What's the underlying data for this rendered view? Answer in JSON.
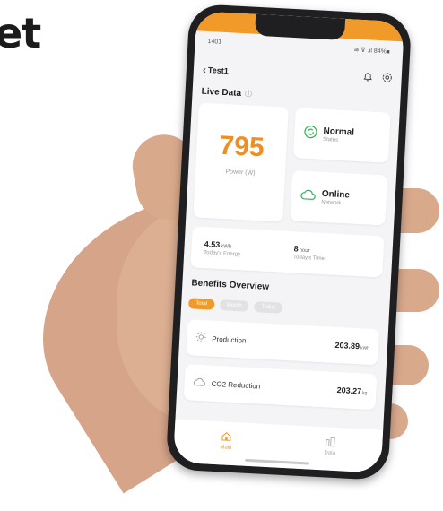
{
  "headline": "et",
  "phone": {
    "status_time": "1401",
    "status_right": "≋ ⊽ .ıl 84%∎",
    "nav": {
      "back_glyph": "‹",
      "device_name": "Test1"
    },
    "live_data": {
      "title": "Live Data",
      "info_glyph": "ⓘ"
    },
    "power": {
      "value": "795",
      "label": "Power (W)"
    },
    "status_card": {
      "title": "Normal",
      "sub": "Status"
    },
    "network_card": {
      "title": "Online",
      "sub": "Network"
    },
    "energy": {
      "value": "4.53",
      "unit": "kWh",
      "label": "Today's Energy"
    },
    "time": {
      "value": "8",
      "unit": "hour",
      "label": "Today's Time"
    },
    "benefits": {
      "title": "Benefits Overview",
      "tabs": [
        "Total",
        "Month",
        "Today"
      ],
      "active_tab": "Total",
      "production": {
        "label": "Production",
        "value": "203.89",
        "unit": "kWh"
      },
      "co2": {
        "label": "CO2 Reduction",
        "value": "203.27",
        "unit": "kg"
      }
    },
    "bottom_nav": {
      "main": "Main",
      "data": "Data"
    },
    "accent_color": "#f09a2a",
    "power_color": "#ef8f22"
  }
}
